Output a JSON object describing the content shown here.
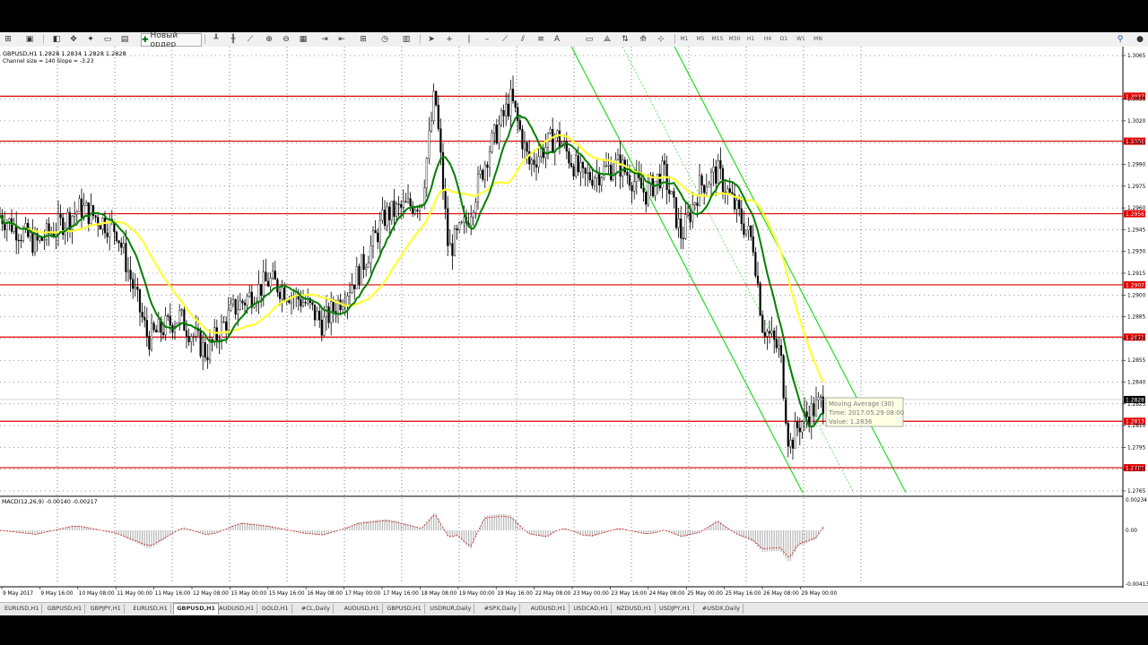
{
  "toolbar": {
    "new_order_label": "Новый ордер",
    "timeframes": [
      "M1",
      "M5",
      "M15",
      "M30",
      "H1",
      "H4",
      "D1",
      "W1",
      "MN"
    ]
  },
  "chart": {
    "header": "GBPUSD,H1  1.2828 1.2834 1.2828 1.2828",
    "channel_info": "Channel size = 140 Slope = -3.23",
    "price_labels": [
      "1.3065",
      "1.3035",
      "1.3020",
      "1.3005",
      "1.2990",
      "1.2975",
      "1.2960",
      "1.2945",
      "1.2930",
      "1.2915",
      "1.2900",
      "1.2885",
      "1.2870",
      "1.2855",
      "1.2840",
      "1.2825",
      "1.2810",
      "1.2795",
      "1.2780",
      "1.2765"
    ],
    "level_tags": [
      "1.3037",
      "1.3006",
      "1.2956",
      "1.2907",
      "1.2871",
      "1.2813",
      "1.2781"
    ],
    "current_price": "1.2828",
    "tooltip": {
      "line1": "Moving Average (30)",
      "line2": "Time: 2017.05.29 08:00",
      "line3": "Value: 1.2836"
    },
    "macd_header": "MACD(12,26,9) -0.00140 -0.00217",
    "macd_labels": [
      "0.00234",
      "0.00",
      "-0.00413"
    ],
    "time_labels": [
      "9 May 2017",
      "9 May 16:00",
      "10 May 08:00",
      "11 May 00:00",
      "11 May 16:00",
      "12 May 08:00",
      "15 May 00:00",
      "15 May 16:00",
      "16 May 08:00",
      "17 May 00:00",
      "17 May 16:00",
      "18 May 08:00",
      "19 May 00:00",
      "19 May 16:00",
      "22 May 08:00",
      "23 May 00:00",
      "23 May 16:00",
      "24 May 08:00",
      "25 May 00:00",
      "25 May 16:00",
      "26 May 08:00",
      "29 May 00:00"
    ],
    "colors": {
      "level": "#e00000",
      "ma_fast": "#008000",
      "ma_slow": "#ffff33",
      "channel": "#33dd33",
      "candle": "#000000"
    }
  },
  "tabs": [
    "EURUSD,H1",
    "GBPUSD,H1",
    "GBPJPY,H1",
    "EURUSD,H1",
    "GBPUSD,H1",
    "AUDUSD,H1",
    "GOLD,H1",
    "#CL,Daily",
    "AUDUSD,H1",
    "GBPUSD,H1",
    "USDRUR,Daily",
    "#SPX,Daily",
    "AUDUSD,H1",
    "USDCAD,H1",
    "NZDUSD,H1",
    "USDJPY,H1",
    "#USDX,Daily"
  ],
  "active_tab": 4
}
